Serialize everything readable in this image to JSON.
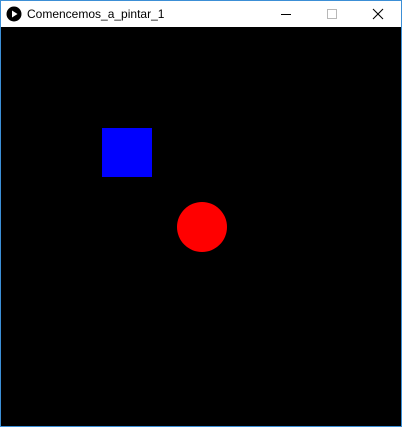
{
  "window": {
    "title": "Comencemos_a_pintar_1",
    "app_icon": "processing-play-icon",
    "controls": {
      "minimize_icon": "minimize-icon",
      "maximize_icon": "maximize-icon",
      "close_icon": "close-icon"
    },
    "border_color": "#3c8fd6"
  },
  "canvas": {
    "background": "#000000",
    "shapes": [
      {
        "name": "blue-square",
        "kind": "rect",
        "fill": "#0000ff"
      },
      {
        "name": "red-circle",
        "kind": "ellipse",
        "fill": "#ff0000"
      }
    ]
  }
}
